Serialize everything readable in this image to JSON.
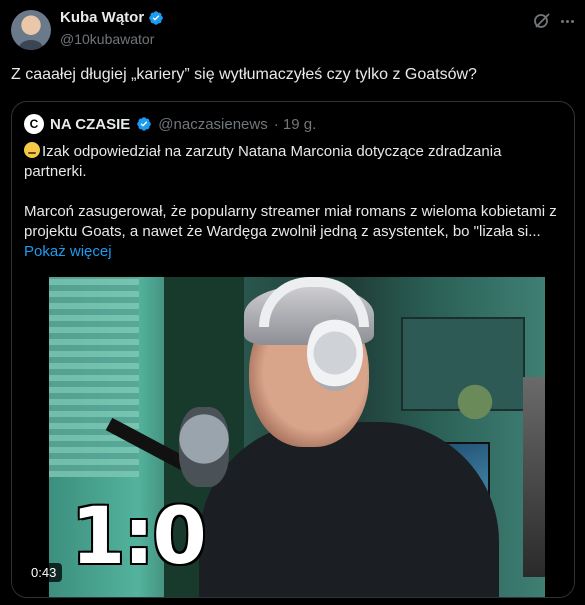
{
  "author": {
    "name": "Kuba Wątor",
    "handle": "@10kubawator"
  },
  "tweet_text": "Z caaałej długiej „kariery” się wytłumaczyłeś czy tylko z Goatsów?",
  "quoted": {
    "logo_letter": "C",
    "name": "NA CZASIE",
    "handle": "@naczasienews",
    "time": "· 19 g.",
    "paragraph1": "Izak odpowiedział na zarzuty Natana Marconia dotyczące zdradzania partnerki.",
    "paragraph2": "Marcoń zasugerował, że popularny streamer miał romans z wieloma kobietami z projektu Goats, a nawet że Wardęga zwolnił jedną z asystentek, bo \"lizała si...",
    "show_more": "Pokaż więcej",
    "video": {
      "score_overlay": "1:0",
      "duration": "0:43"
    }
  },
  "colors": {
    "accent": "#1d9bf0",
    "muted": "#71767b",
    "text": "#e7e9ea",
    "border": "#2f3336"
  },
  "icons": [
    "verified-badge-icon",
    "grok-icon",
    "more-options-icon",
    "thinking-emoji-icon"
  ]
}
